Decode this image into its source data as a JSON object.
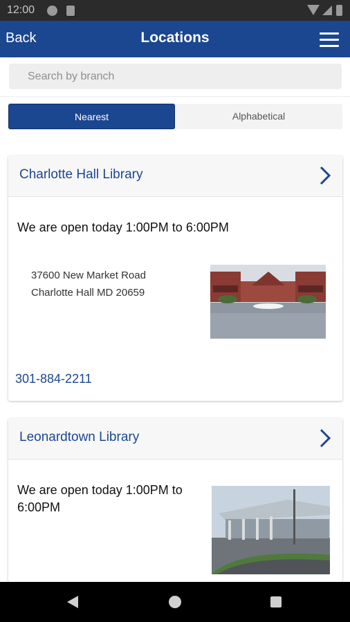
{
  "status_bar": {
    "time": "12:00"
  },
  "app_bar": {
    "back_label": "Back",
    "title": "Locations"
  },
  "search": {
    "placeholder": "Search by branch",
    "value": ""
  },
  "sort_toggle": {
    "options": [
      "Nearest",
      "Alphabetical"
    ],
    "selected": "Nearest"
  },
  "locations": [
    {
      "name": "Charlotte Hall Library",
      "hours": "We are open today 1:00PM to 6:00PM",
      "address_line1": "37600 New Market Road",
      "address_line2": "Charlotte Hall MD 20659",
      "phone": "301-884-2211"
    },
    {
      "name": "Leonardtown Library",
      "hours_line1": "We are open today 1:00PM to",
      "hours_line2": "6:00PM"
    }
  ],
  "colors": {
    "brand": "#1b4690",
    "status_bar": "#2b2b2b",
    "nav_bar": "#000000"
  },
  "icons": [
    "menu-icon",
    "chevron-right-icon",
    "nav-back-icon",
    "nav-home-icon",
    "nav-recents-icon"
  ]
}
